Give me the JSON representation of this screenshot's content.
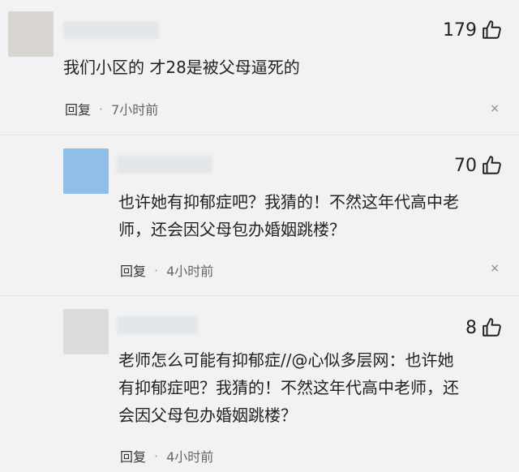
{
  "comments": [
    {
      "likes": "179",
      "text_lines": [
        "我们小区的 才28是被父母逼死的"
      ],
      "reply_label": "回复",
      "dot": "·",
      "time": "7小时前",
      "close": "×",
      "avatar_color": "#d8d5d0"
    },
    {
      "likes": "70",
      "text_lines": [
        "也许她有抑郁症吧？我猜的！不然这年代高中老",
        "师，还会因父母包办婚姻跳楼？"
      ],
      "reply_label": "回复",
      "dot": "·",
      "time": "4小时前",
      "close": "×",
      "avatar_color": "#8fbfe8"
    },
    {
      "likes": "8",
      "text_lines": [
        "老师怎么可能有抑郁症//@心似多层网：也许她",
        "有抑郁症吧？我猜的！不然这年代高中老师，还",
        "会因父母包办婚姻跳楼？"
      ],
      "reply_label": "回复",
      "dot": "·",
      "time": "4小时前",
      "close": "×",
      "avatar_color": "#dcdcdc"
    }
  ]
}
